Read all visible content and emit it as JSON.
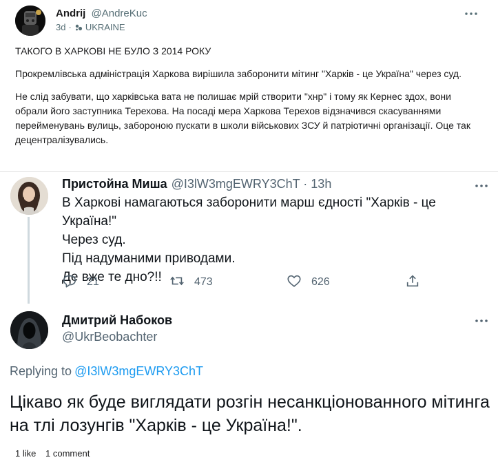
{
  "post": {
    "author_name": "Andrij",
    "author_handle": "@AndreKuc",
    "age": "3d",
    "separator": "·",
    "flair": "UKRAINE",
    "paragraphs": [
      "ТАКОГО В ХАРКОВІ НЕ БУЛО З 2014 РОКУ",
      "Прокремлівська адміністрація Харкова вирішила заборонити мітинг \"Харків - це Україна\" через суд.",
      "Не слід забувати, що харківська вата не полишає мрій створити \"хнр\" і тому як Кернес здох, вони обрали його заступника Терехова. На посаді мера Харкова Терехов відзначився скасуваннями перейменувань вулиць, забороною пускати в школи військових ЗСУ й патріотичні організації. Оце так децентралізувались."
    ],
    "likes_label": "1 like",
    "comments_label": "1 comment"
  },
  "tweet1": {
    "name": "Пристойна Миша",
    "handle": "@I3lW3mgEWRY3ChT",
    "separator": "·",
    "time": "13h",
    "lines": [
      "В Харкові намагаються заборонити марш єдності \"Харків - це Україна!\"",
      "Через суд.",
      "Під надуманими приводами.",
      "Де вже те дно?!!"
    ],
    "replies": "21",
    "retweets": "473",
    "likes": "626"
  },
  "tweet2": {
    "name": "Дмитрий Набоков",
    "handle": "@UkrBeobachter",
    "replying_label": "Replying to",
    "replying_handle": "@I3lW3mgEWRY3ChT",
    "text": "Цікаво як буде виглядати розгін несанкціонованного мітинга на тлі лозунгів \"Харків - це Україна!\"."
  },
  "icons": {
    "more": "more-horizontal-icon",
    "reply": "reply-bubble-icon",
    "retweet": "retweet-icon",
    "like": "heart-icon",
    "share": "share-icon",
    "flair": "community-icon"
  },
  "colors": {
    "twitter_blue": "#1d9bf0",
    "muted": "#536471",
    "reddit_muted": "#576f76"
  }
}
